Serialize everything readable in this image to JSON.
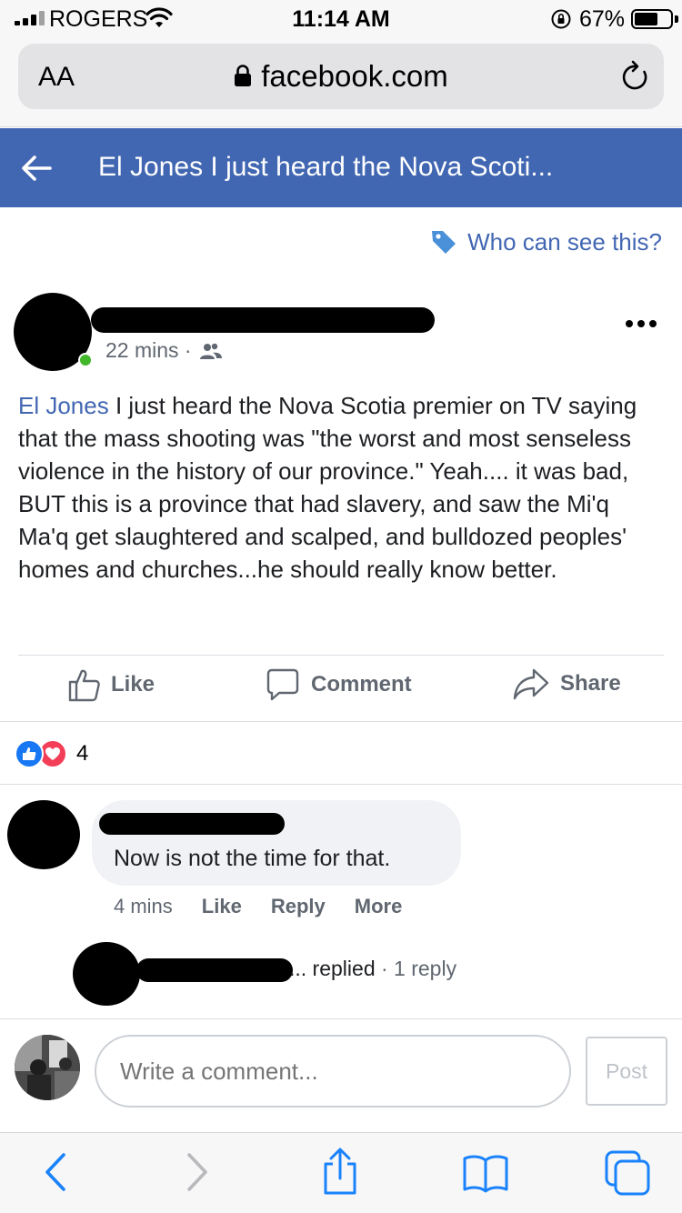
{
  "status_bar": {
    "carrier": "ROGERS",
    "time": "11:14 AM",
    "battery_percent": "67%",
    "battery_level": 0.67
  },
  "browser": {
    "text_size_label": "AA",
    "url": "facebook.com"
  },
  "header": {
    "title": "El Jones I just heard the Nova Scoti..."
  },
  "privacy": {
    "label": "Who can see this?"
  },
  "post": {
    "timestamp": "22 mins ·",
    "author": "El Jones",
    "body": " I just heard the Nova Scotia premier on TV saying that the mass shooting was \"the worst and most senseless violence in the history of our province.\" Yeah.... it was bad, BUT this is a province that had slavery, and saw the Mi'q Ma'q get slaughtered and scalped, and bulldozed peoples' homes and churches...he should really know better."
  },
  "actions": {
    "like": "Like",
    "comment": "Comment",
    "share": "Share"
  },
  "reactions": {
    "count": "4"
  },
  "comment": {
    "text": "Now is not the time for that.",
    "time": "4 mins",
    "like": "Like",
    "reply": "Reply",
    "more": "More",
    "replied_suffix": "... replied",
    "reply_count": " · 1 reply"
  },
  "composer": {
    "placeholder": "Write a comment...",
    "post_label": "Post"
  },
  "colors": {
    "facebook_blue": "#4267b2",
    "safari_blue": "#1a82fb",
    "online_green": "#42b72a",
    "love_red": "#f33e58"
  }
}
